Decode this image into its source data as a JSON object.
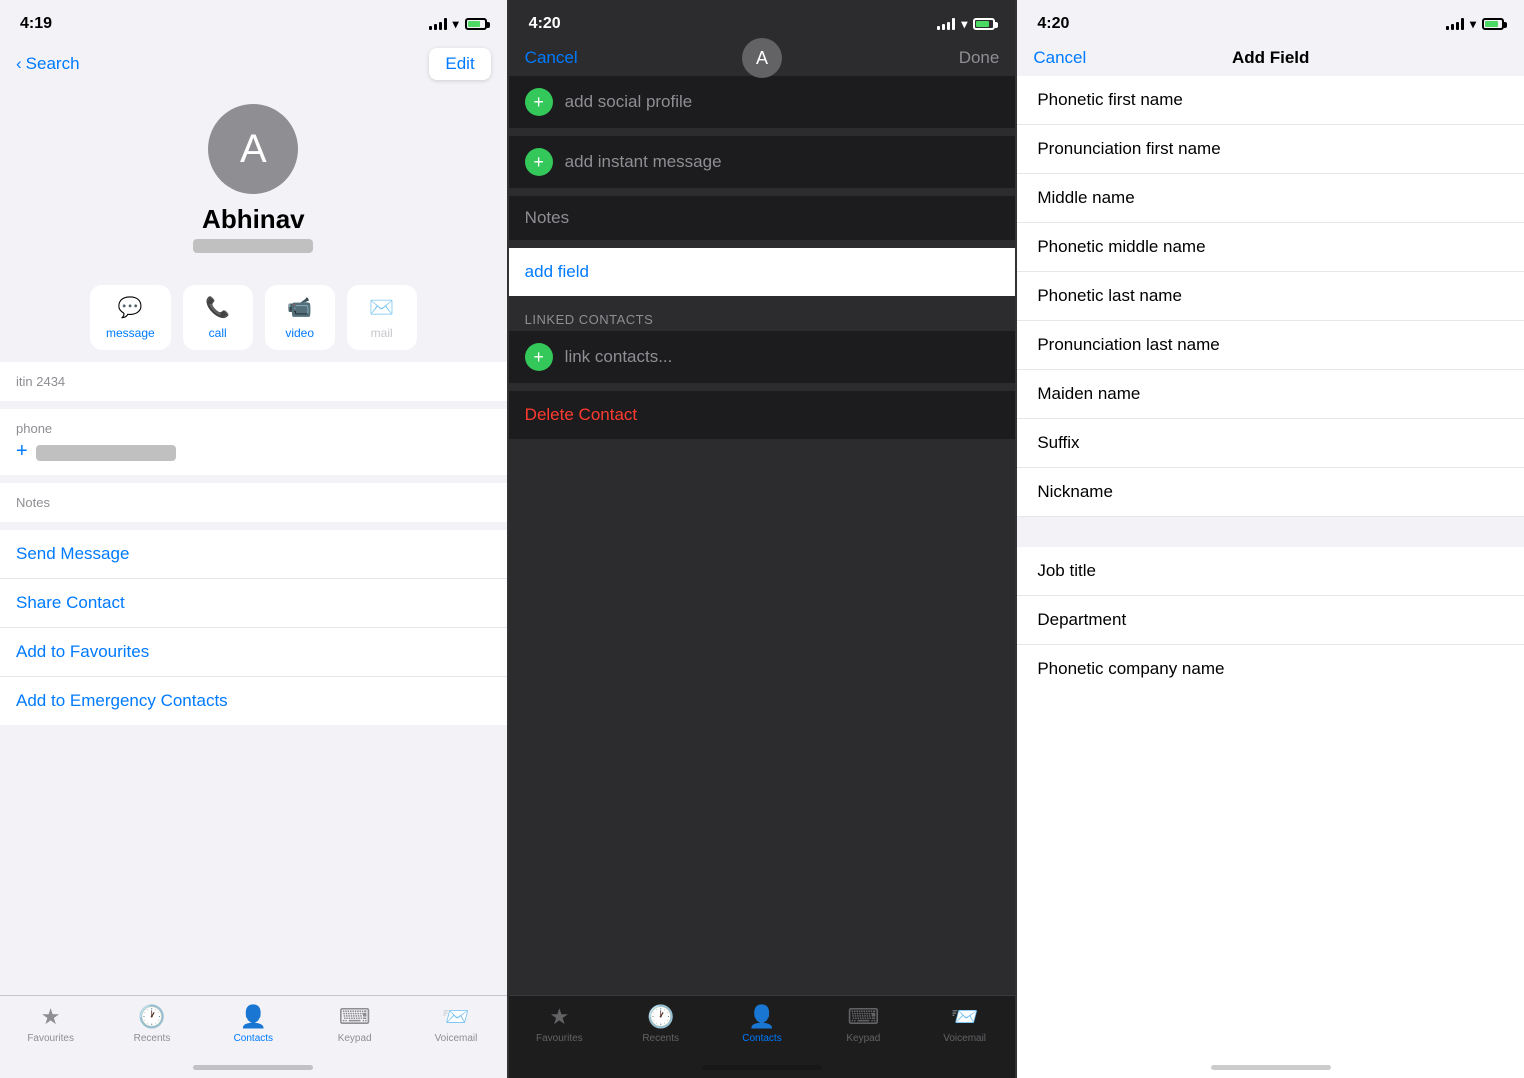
{
  "screen1": {
    "status_bar": {
      "time": "4:19"
    },
    "nav": {
      "back_label": "Search",
      "edit_label": "Edit"
    },
    "contact": {
      "avatar_initial": "A",
      "name": "Abhinav"
    },
    "action_buttons": [
      {
        "icon": "💬",
        "label": "message",
        "active": true
      },
      {
        "icon": "📞",
        "label": "call",
        "active": true
      },
      {
        "icon": "📹",
        "label": "video",
        "active": true
      },
      {
        "icon": "✉️",
        "label": "mail",
        "active": false
      }
    ],
    "phone_label": "phone",
    "notes_label": "Notes",
    "actions": [
      "Send Message",
      "Share Contact",
      "Add to Favourites",
      "Add to Emergency Contacts"
    ],
    "tab_bar": {
      "items": [
        {
          "icon": "★",
          "label": "Favourites",
          "active": false
        },
        {
          "icon": "🕐",
          "label": "Recents",
          "active": false
        },
        {
          "icon": "👤",
          "label": "Contacts",
          "active": true
        },
        {
          "icon": "⌨",
          "label": "Keypad",
          "active": false
        },
        {
          "icon": "📨",
          "label": "Voicemail",
          "active": false
        }
      ]
    }
  },
  "screen2": {
    "status_bar": {
      "time": "4:20"
    },
    "nav": {
      "cancel_label": "Cancel",
      "done_label": "Done"
    },
    "avatar_initial": "A",
    "rows": [
      {
        "type": "add",
        "label": "add social profile"
      },
      {
        "type": "add",
        "label": "add instant message"
      }
    ],
    "notes_label": "Notes",
    "add_field_label": "add field",
    "linked_contacts_header": "LINKED CONTACTS",
    "link_contacts_label": "link contacts...",
    "delete_label": "Delete Contact",
    "tab_bar": {
      "items": [
        {
          "icon": "★",
          "label": "Favourites",
          "active": false
        },
        {
          "icon": "🕐",
          "label": "Recents",
          "active": false
        },
        {
          "icon": "👤",
          "label": "Contacts",
          "active": true
        },
        {
          "icon": "⌨",
          "label": "Keypad",
          "active": false
        },
        {
          "icon": "📨",
          "label": "Voicemail",
          "active": false
        }
      ]
    }
  },
  "screen3": {
    "status_bar": {
      "time": "4:20"
    },
    "nav": {
      "cancel_label": "Cancel",
      "title": "Add Field"
    },
    "fields_group1": [
      "Phonetic first name",
      "Pronunciation first name",
      "Middle name",
      "Phonetic middle name",
      "Phonetic last name",
      "Pronunciation last name",
      "Maiden name",
      "Suffix",
      "Nickname"
    ],
    "fields_group2": [
      "Job title",
      "Department",
      "Phonetic company name"
    ]
  }
}
